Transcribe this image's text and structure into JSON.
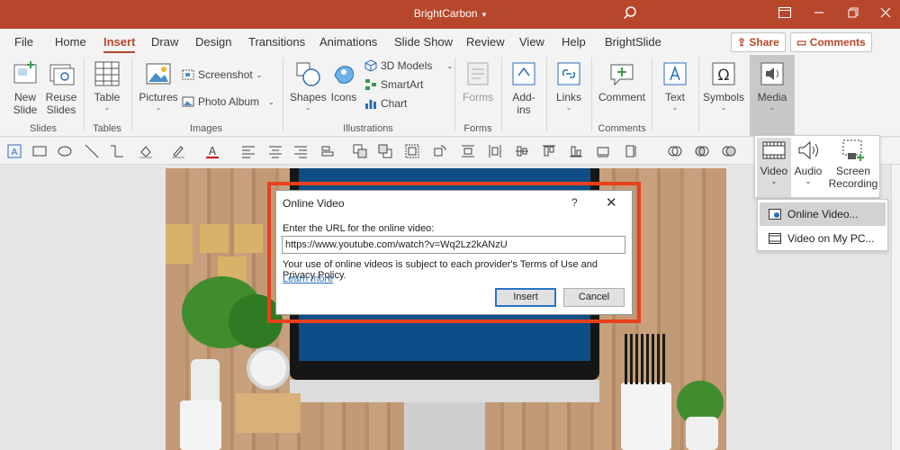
{
  "titlebar": {
    "title": "BrightCarbon",
    "caret": "▾"
  },
  "menu": {
    "tabs": [
      "File",
      "Home",
      "Insert",
      "Draw",
      "Design",
      "Transitions",
      "Animations",
      "Slide Show",
      "Review",
      "View",
      "Help",
      "BrightSlide"
    ],
    "active": "Insert",
    "share_label": "Share",
    "comments_label": "Comments"
  },
  "ribbon": {
    "slides": {
      "new_slide": "New Slide",
      "reuse_slides": "Reuse Slides",
      "group": "Slides"
    },
    "tables": {
      "table": "Table",
      "group": "Tables"
    },
    "images": {
      "pictures": "Pictures",
      "screenshot": "Screenshot",
      "photo_album": "Photo Album",
      "group": "Images"
    },
    "illustrations": {
      "shapes": "Shapes",
      "icons": "Icons",
      "models": "3D Models",
      "smartart": "SmartArt",
      "chart": "Chart",
      "group": "Illustrations"
    },
    "forms": {
      "forms": "Forms",
      "group": "Forms"
    },
    "addins": {
      "label": "Add-ins"
    },
    "links": {
      "label": "Links"
    },
    "comments": {
      "comment": "Comment",
      "group": "Comments"
    },
    "text": {
      "label": "Text"
    },
    "symbols": {
      "label": "Symbols"
    },
    "media": {
      "label": "Media"
    }
  },
  "media_panel": {
    "video": "Video",
    "audio": "Audio",
    "screen_recording": "Screen Recording"
  },
  "video_menu": {
    "online_video": "Online Video...",
    "video_on_pc": "Video on My PC..."
  },
  "dialog": {
    "title": "Online Video",
    "help": "?",
    "close": "✕",
    "prompt": "Enter the URL for the online video:",
    "url": "https://www.youtube.com/watch?v=Wq2Lz2kANzU",
    "terms": "Your use of online videos is subject to each provider's Terms of Use and Privacy Policy.",
    "learn_more": "Learn more",
    "insert": "Insert",
    "cancel": "Cancel"
  },
  "colors": {
    "accent": "#b7472a",
    "highlight": "#e8401c",
    "link": "#2a6ebb"
  }
}
